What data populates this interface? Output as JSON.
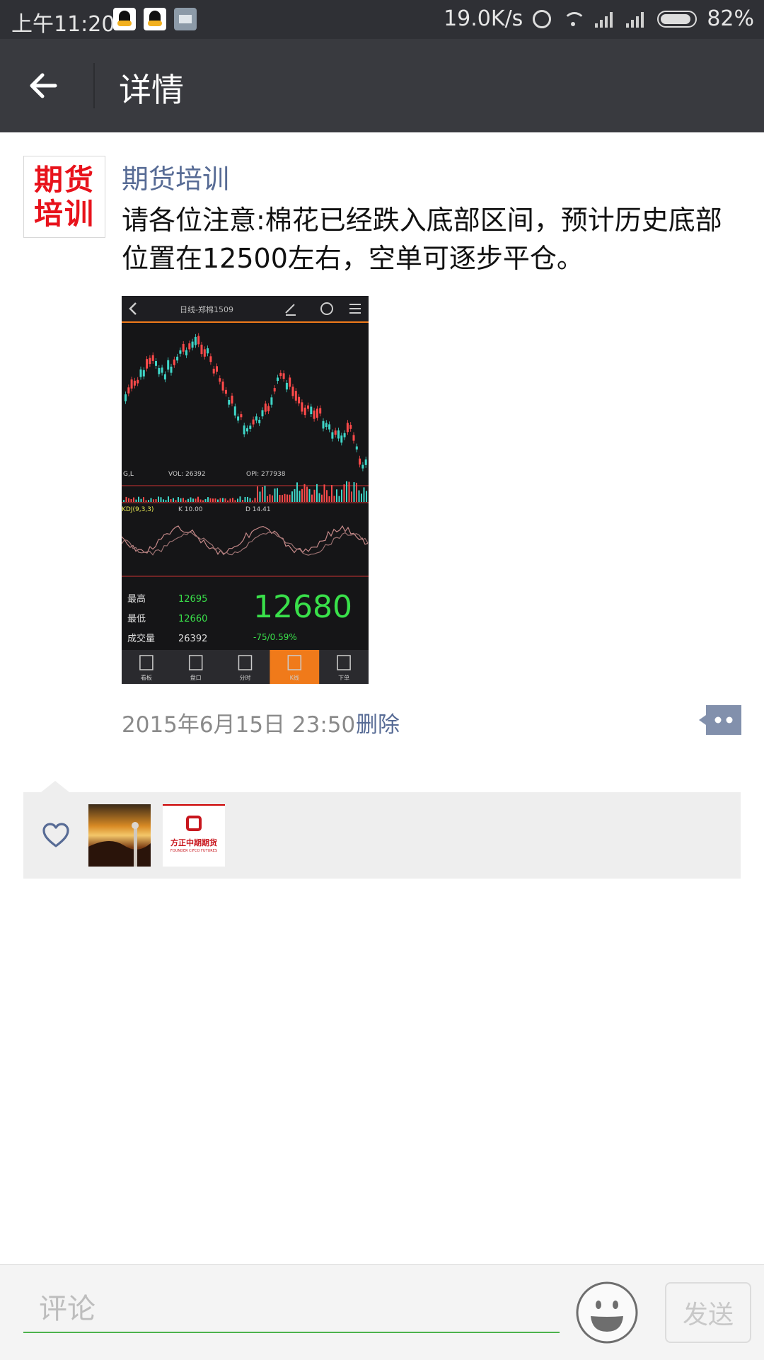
{
  "status_bar": {
    "time": "上午11:20",
    "speed": "19.0K/s",
    "battery": "82%",
    "apps": [
      "qq-icon",
      "qq-icon",
      "document-icon"
    ]
  },
  "header": {
    "title": "详情",
    "back_icon": "back-arrow-icon"
  },
  "post": {
    "avatar_text": "期货培训",
    "author": "期货培训",
    "content": "请各位注意:棉花已经跌入底部区间，预计历史底部位置在12500左右，空单可逐步平仓。",
    "image": {
      "title": "日线-郑棉1509",
      "vol_label": "VOL: 26392",
      "opi_label": "OPI: 277938",
      "labels_row": [
        "K 10.00",
        "D 14.41"
      ],
      "price": "12680",
      "change": "-75/0.59%",
      "stats": [
        {
          "label": "最高",
          "value": "12695"
        },
        {
          "label": "最低",
          "value": "12660"
        },
        {
          "label": "成交量",
          "value": "26392"
        }
      ],
      "tabs": [
        "看板",
        "盘口",
        "分时",
        "K线",
        "下单"
      ],
      "active_tab": 3,
      "colors": {
        "up": "#ff4a4a",
        "down": "#3fd6c8",
        "price": "#39e04a",
        "accent": "#f07a1a"
      }
    },
    "time": "2015年6月15日 23:50",
    "delete_label": "删除"
  },
  "likes": {
    "icon": "heart-icon",
    "users": [
      {
        "name": "sunset-avatar"
      },
      {
        "name": "founder-avatar",
        "text": "方正中期期货",
        "subtext": "FOUNDER CIFCO FUTURES"
      }
    ]
  },
  "comment_bar": {
    "placeholder": "评论",
    "send_label": "发送"
  }
}
